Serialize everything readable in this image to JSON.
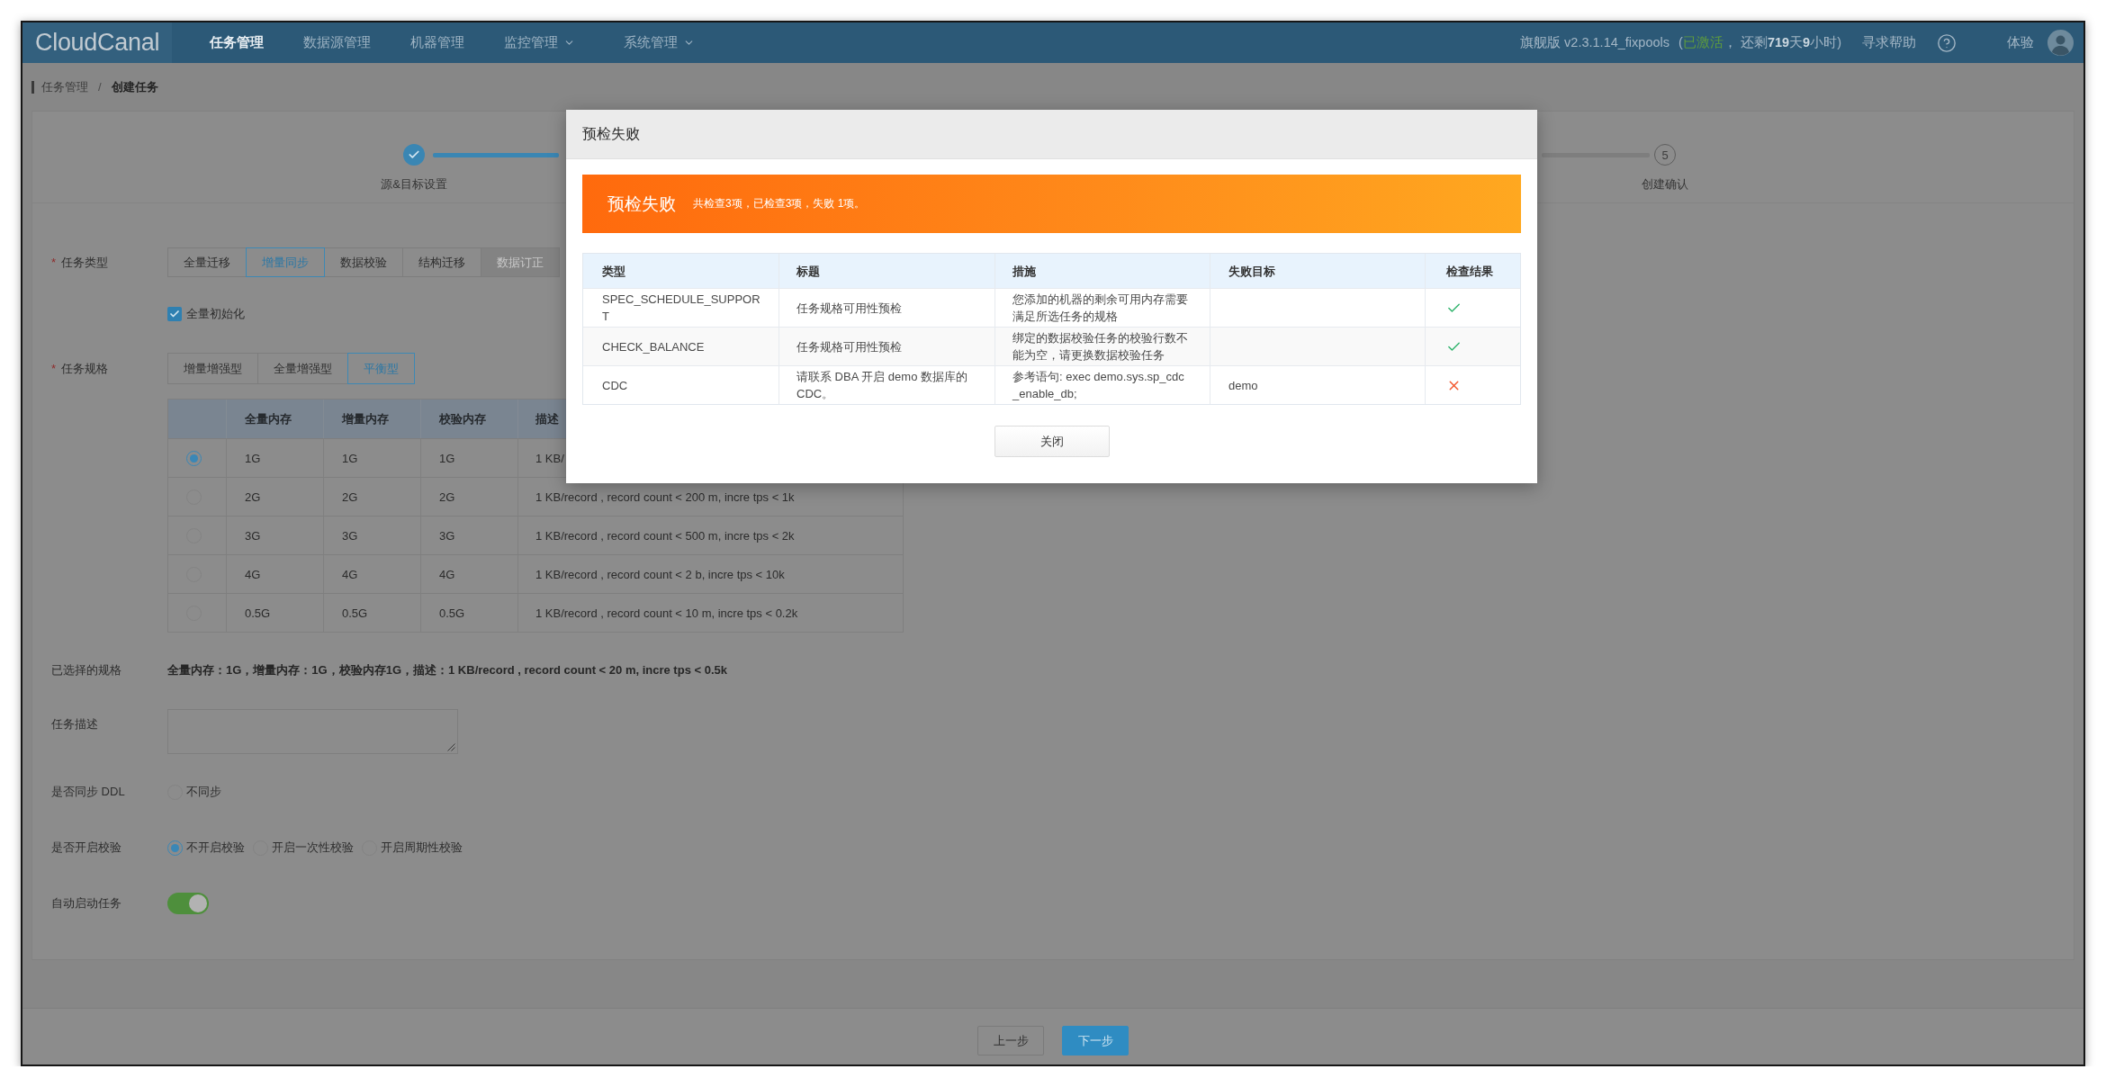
{
  "nav": {
    "logo": "CloudCanal",
    "items": [
      {
        "label": "任务管理",
        "selected": true,
        "dropdown": false
      },
      {
        "label": "数据源管理",
        "selected": false,
        "dropdown": false
      },
      {
        "label": "机器管理",
        "selected": false,
        "dropdown": false
      },
      {
        "label": "监控管理",
        "selected": false,
        "dropdown": true
      },
      {
        "label": "系统管理",
        "selected": false,
        "dropdown": true
      }
    ],
    "version": "旗舰版 v2.3.1.14_fixpools",
    "license": {
      "prefix": "(",
      "status": "已激活",
      "activated": true,
      "suffix": "， 还剩**719**天**9**小时)"
    },
    "help": "寻求帮助",
    "user": "体验"
  },
  "breadcrumb": {
    "items": [
      {
        "label": "任务管理",
        "current": false
      },
      {
        "label": "创建任务",
        "current": true
      }
    ],
    "separator": "/"
  },
  "steps": [
    {
      "label": "源&目标设置",
      "done": true
    },
    {
      "number": "5",
      "label": "创建确认",
      "done": false
    }
  ],
  "form": {
    "task_type": {
      "marker": "*",
      "label": "任务类型",
      "options": [
        {
          "label": "全量迁移",
          "selected": false,
          "disabled": false
        },
        {
          "label": "增量同步",
          "selected": true,
          "disabled": false
        },
        {
          "label": "数据校验",
          "selected": false,
          "disabled": false
        },
        {
          "label": "结构迁移",
          "selected": false,
          "disabled": false
        },
        {
          "label": "数据订正",
          "selected": false,
          "disabled": true
        }
      ]
    },
    "full_init": {
      "label": "全量初始化",
      "checked": true
    },
    "task_spec": {
      "marker": "*",
      "label": "任务规格",
      "options": [
        {
          "label": "增量增强型",
          "selected": false
        },
        {
          "label": "全量增强型",
          "selected": false
        },
        {
          "label": "平衡型",
          "selected": true
        }
      ],
      "table": {
        "columns": [
          "全量内存",
          "增量内存",
          "校验内存",
          "描述"
        ],
        "rows": [
          {
            "selected": true,
            "cells": [
              "1G",
              "1G",
              "1G",
              "1 KB/"
            ]
          },
          {
            "selected": false,
            "cells": [
              "2G",
              "2G",
              "2G",
              "1 KB/record , record count < 200 m, incre tps < 1k"
            ]
          },
          {
            "selected": false,
            "cells": [
              "3G",
              "3G",
              "3G",
              "1 KB/record , record count < 500 m, incre tps < 2k"
            ]
          },
          {
            "selected": false,
            "cells": [
              "4G",
              "4G",
              "4G",
              "1 KB/record , record count < 2 b, incre tps < 10k"
            ]
          },
          {
            "selected": false,
            "cells": [
              "0.5G",
              "0.5G",
              "0.5G",
              "1 KB/record , record count < 10 m, incre tps < 0.2k"
            ]
          }
        ]
      }
    },
    "selected_spec": {
      "label": "已选择的规格",
      "value": "全量内存：1G，增量内存：1G，校验内存1G，描述：1 KB/record , record count < 20 m, incre tps < 0.5k"
    },
    "description": {
      "label": "任务描述"
    },
    "sync_ddl": {
      "label": "是否同步 DDL",
      "options": [
        {
          "label": "不同步",
          "selected": false
        }
      ]
    },
    "verify": {
      "label": "是否开启校验",
      "options": [
        {
          "label": "不开启校验",
          "selected": true
        },
        {
          "label": "开启一次性校验",
          "selected": false
        },
        {
          "label": "开启周期性校验",
          "selected": false
        }
      ]
    },
    "auto_start": {
      "label": "自动启动任务",
      "on": true
    }
  },
  "footer": {
    "buttons": [
      {
        "label": "上一步",
        "primary": false
      },
      {
        "label": "下一步",
        "primary": true
      }
    ]
  },
  "dialog": {
    "title": "预检失败",
    "banner": {
      "title": "预检失败",
      "summary": "共检查3项，已检查3项，失败 1项。"
    },
    "table": {
      "columns": [
        "类型",
        "标题",
        "措施",
        "失败目标",
        "检查结果"
      ],
      "rows": [
        {
          "type": "SPEC_SCHEDULE_SUPPORT",
          "title": "任务规格可用性预检",
          "measure": "您添加的机器的剩余可用内存需要满足所选任务的规格",
          "passed": true
        },
        {
          "type": "CHECK_BALANCE",
          "title": "任务规格可用性预检",
          "measure": "绑定的数据校验任务的校验行数不能为空，请更换数据校验任务",
          "passed": true
        },
        {
          "type": "CDC",
          "title": "请联系 DBA 开启 demo 数据库的 CDC。",
          "measure": "参考语句: exec demo.sys.sp_cdc_enable_db;",
          "target": "demo",
          "passed": false
        }
      ]
    },
    "close": "关闭"
  }
}
